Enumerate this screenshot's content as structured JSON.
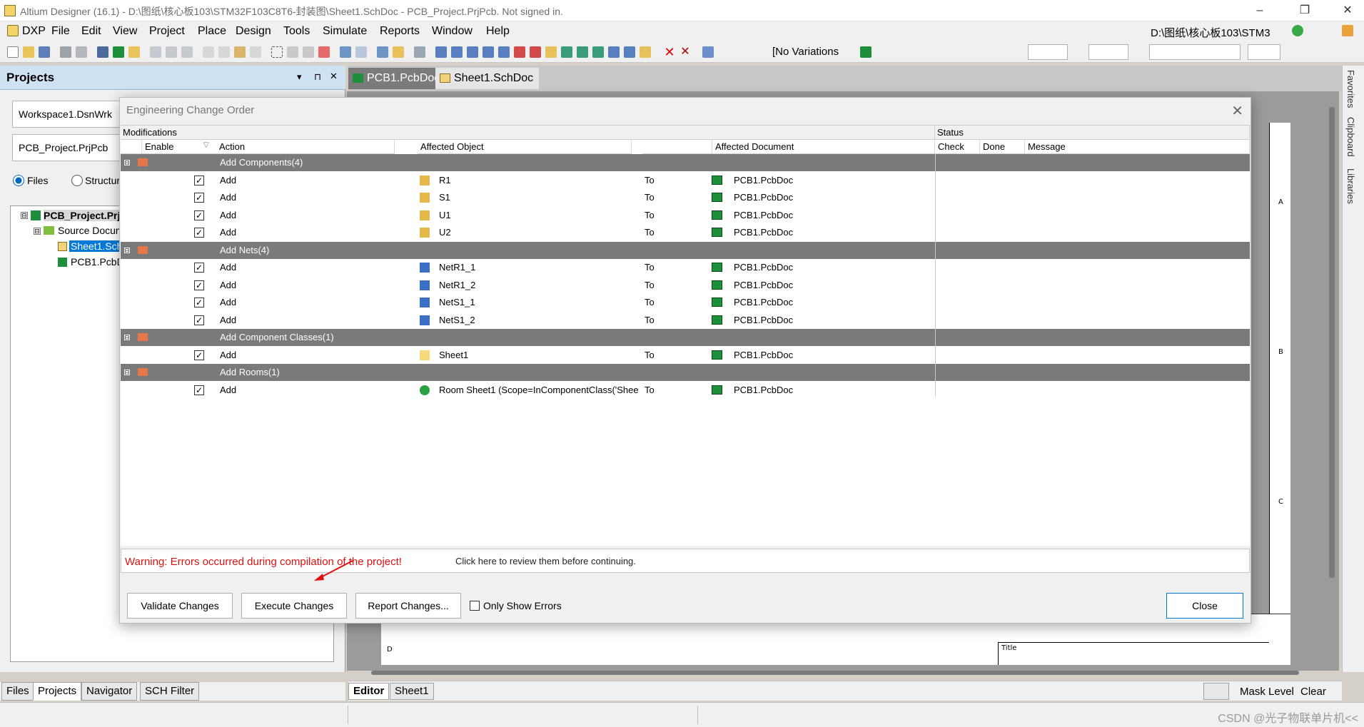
{
  "window": {
    "title": "Altium Designer (16.1) - D:\\图纸\\核心板103\\STM32F103C8T6-封装图\\Sheet1.SchDoc - PCB_Project.PrjPcb. Not signed in.",
    "controls": [
      "–",
      "❐",
      "✕"
    ]
  },
  "menu": {
    "items": [
      "DXP",
      "File",
      "Edit",
      "View",
      "Project",
      "Place",
      "Design",
      "Tools",
      "Simulate",
      "Reports",
      "Window",
      "Help"
    ],
    "path_box": "D:\\图纸\\核心板103\\STM3"
  },
  "toolbar": {
    "variations": "[No Variations"
  },
  "projects_panel": {
    "title": "Projects",
    "pin_icons": [
      "▾",
      "⊓",
      "✕"
    ],
    "workspace": "Workspace1.DsnWrk",
    "project": "PCB_Project.PrjPcb",
    "view_files": "Files",
    "view_structure": "Structur",
    "tree": {
      "project": "PCB_Project.Prj",
      "source_documents": "Source Docum",
      "sheet": "Sheet1.Sch",
      "pcb": "PCB1.PcbD"
    },
    "bottom_tabs": [
      "Files",
      "Projects",
      "Navigator",
      "SCH Filter"
    ]
  },
  "doc_tabs": [
    {
      "label": "PCB1.PcbDoc",
      "active": false
    },
    {
      "label": "Sheet1.SchDoc",
      "active": true
    }
  ],
  "right_tabs": [
    "Favorites",
    "Clipboard",
    "Libraries"
  ],
  "sheet_letters": [
    "A",
    "B",
    "C",
    "D",
    "D",
    "Title"
  ],
  "editor_tabs": [
    "Editor",
    "Sheet1"
  ],
  "status_right": [
    "Mask Level",
    "Clear"
  ],
  "watermark": "CSDN @光子物联单片机<<",
  "eco": {
    "title": "Engineering Change Order",
    "close_x": "✕",
    "group_headers": {
      "modifications": "Modifications",
      "status": "Status"
    },
    "columns": {
      "enable": "Enable",
      "action": "Action",
      "affected_object": "Affected Object",
      "affected_document": "Affected Document",
      "check": "Check",
      "done": "Done",
      "message": "Message"
    },
    "groups": [
      {
        "label": "Add Components(4)",
        "rows": [
          {
            "action": "Add",
            "object": "R1",
            "to": "To",
            "doc": "PCB1.PcbDoc",
            "icon": "component-icon"
          },
          {
            "action": "Add",
            "object": "S1",
            "to": "To",
            "doc": "PCB1.PcbDoc",
            "icon": "component-icon"
          },
          {
            "action": "Add",
            "object": "U1",
            "to": "To",
            "doc": "PCB1.PcbDoc",
            "icon": "component-icon"
          },
          {
            "action": "Add",
            "object": "U2",
            "to": "To",
            "doc": "PCB1.PcbDoc",
            "icon": "component-icon"
          }
        ]
      },
      {
        "label": "Add Nets(4)",
        "rows": [
          {
            "action": "Add",
            "object": "NetR1_1",
            "to": "To",
            "doc": "PCB1.PcbDoc",
            "icon": "net-icon"
          },
          {
            "action": "Add",
            "object": "NetR1_2",
            "to": "To",
            "doc": "PCB1.PcbDoc",
            "icon": "net-icon"
          },
          {
            "action": "Add",
            "object": "NetS1_1",
            "to": "To",
            "doc": "PCB1.PcbDoc",
            "icon": "net-icon"
          },
          {
            "action": "Add",
            "object": "NetS1_2",
            "to": "To",
            "doc": "PCB1.PcbDoc",
            "icon": "net-icon"
          }
        ]
      },
      {
        "label": "Add Component Classes(1)",
        "rows": [
          {
            "action": "Add",
            "object": "Sheet1",
            "to": "To",
            "doc": "PCB1.PcbDoc",
            "icon": "folder-icon"
          }
        ]
      },
      {
        "label": "Add Rooms(1)",
        "rows": [
          {
            "action": "Add",
            "object": "Room Sheet1 (Scope=InComponentClass('Shee",
            "to": "To",
            "doc": "PCB1.PcbDoc",
            "icon": "room-icon"
          }
        ]
      }
    ],
    "warning": "Warning: Errors occurred during compilation of the project!",
    "warning_link": "Click here to review them before continuing.",
    "buttons": {
      "validate": "Validate Changes",
      "execute": "Execute Changes",
      "report": "Report Changes...",
      "only_show_errors": "Only Show Errors",
      "close": "Close"
    }
  }
}
